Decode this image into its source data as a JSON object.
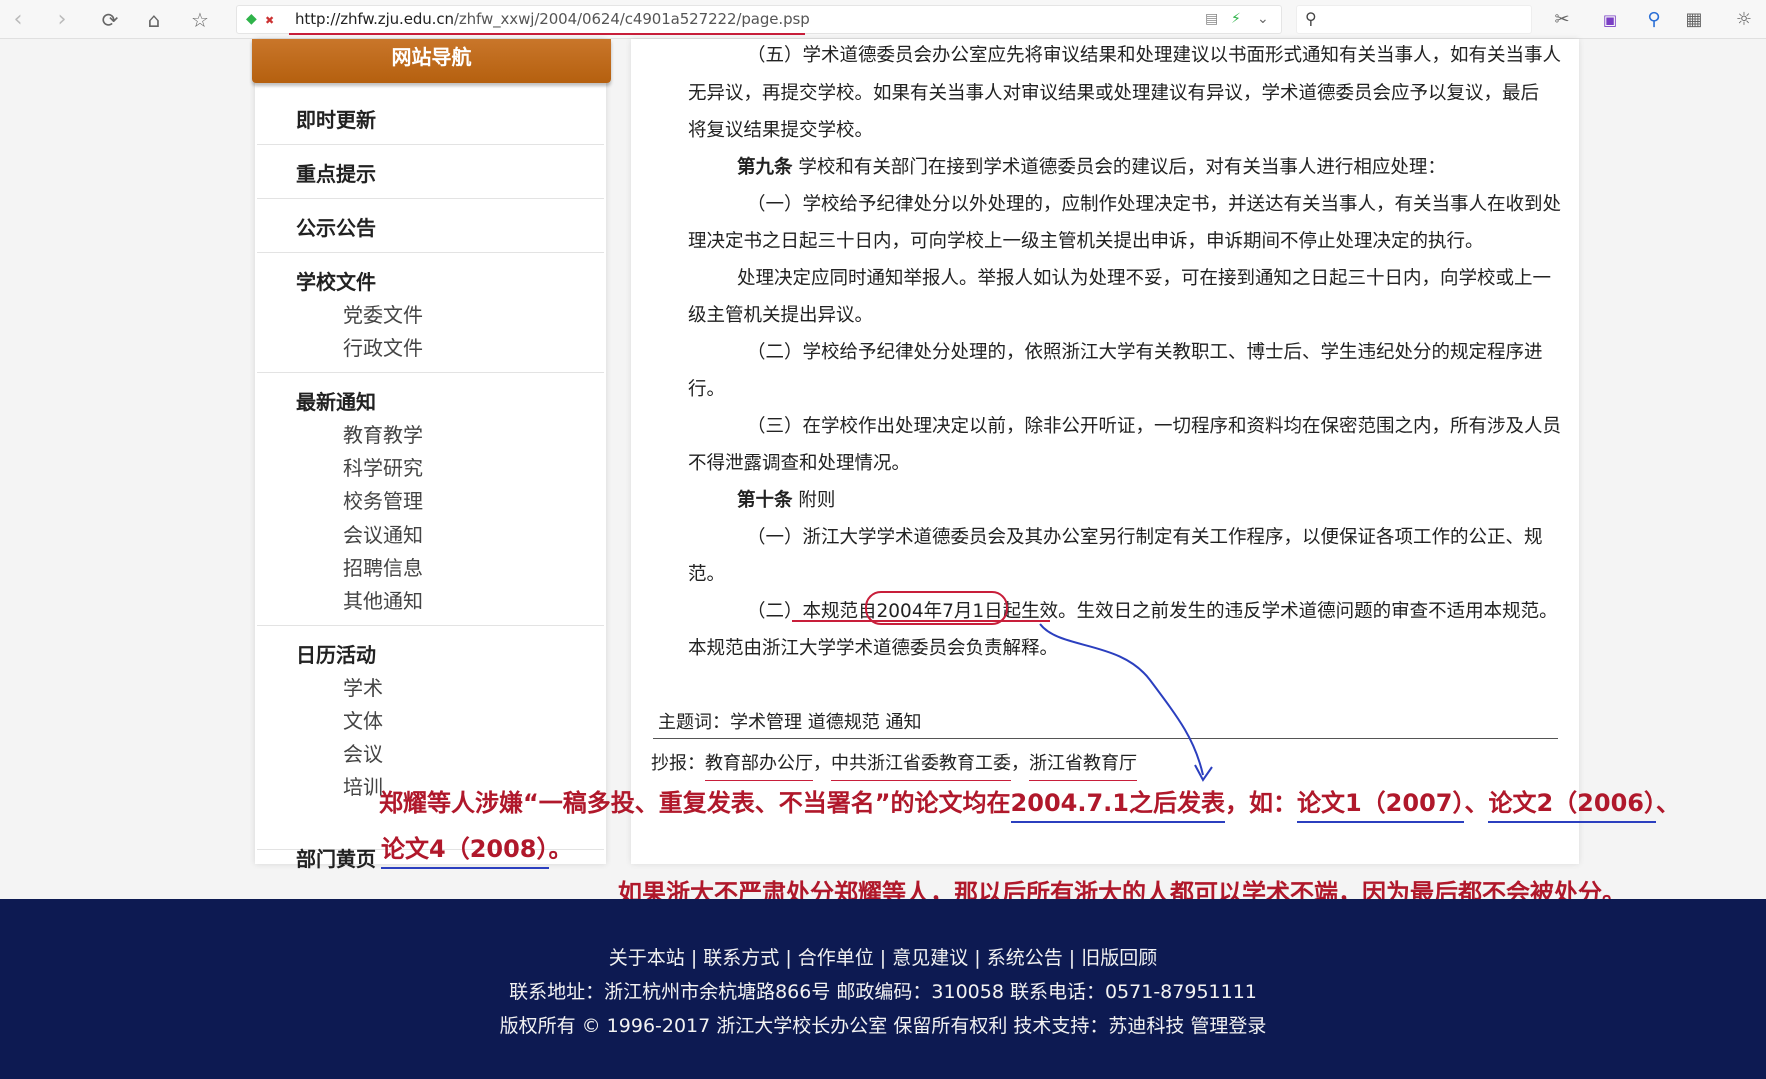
{
  "browser": {
    "url_host": "http://zhfw.zju.edu.cn",
    "url_path": "/zhfw_xxwj/2004/0624/c4901a527222/page.psp",
    "search_placeholder": "",
    "icons": [
      "back-icon",
      "forward-icon",
      "reload-icon",
      "home-icon",
      "star-icon",
      "shield-icon",
      "lightning-icon",
      "chevron-down-icon",
      "search-icon",
      "scissors-icon",
      "translate-icon",
      "zoom-icon",
      "grid-icon",
      "settings-icon"
    ]
  },
  "sidebar": {
    "title": "网站导航",
    "sections": [
      {
        "label": "即时更新",
        "items": []
      },
      {
        "label": "重点提示",
        "items": []
      },
      {
        "label": "公示公告",
        "items": []
      },
      {
        "label": "学校文件",
        "items": [
          "党委文件",
          "行政文件"
        ]
      },
      {
        "label": "最新通知",
        "items": [
          "教育教学",
          "科学研究",
          "校务管理",
          "会议通知",
          "招聘信息",
          "其他通知"
        ]
      },
      {
        "label": "日历活动",
        "items": [
          "学术",
          "文体",
          "会议",
          "培训"
        ]
      },
      {
        "label": "部门黄页",
        "items": []
      }
    ]
  },
  "article": {
    "p1_l1": "（五）学术道德委员会办公室应先将审议结果和处理建议以书面形式通知有关当事人，如有关当事人",
    "p1_l2": "无异议，再提交学校。如果有关当事人对审议结果或处理建议有异议，学术道德委员会应予以复议，最后",
    "p1_l3": "将复议结果提交学校。",
    "art9_title": "第九条",
    "art9_text": "学校和有关部门在接到学术道德委员会的建议后，对有关当事人进行相应处理：",
    "p2_l1": "（一）学校给予纪律处分以外处理的，应制作处理决定书，并送达有关当事人，有关当事人在收到处",
    "p2_l2": "理决定书之日起三十日内，可向学校上一级主管机关提出申诉，申诉期间不停止处理决定的执行。",
    "p3_l1": "处理决定应同时通知举报人。举报人如认为处理不妥，可在接到通知之日起三十日内，向学校或上一",
    "p3_l2": "级主管机关提出异议。",
    "p4_l1": "（二）学校给予纪律处分处理的，依照浙江大学有关教职工、博士后、学生违纪处分的规定程序进",
    "p4_l2": "行。",
    "p5_l1": "（三）在学校作出处理决定以前，除非公开听证，一切程序和资料均在保密范围之内，所有涉及人员",
    "p5_l2": "不得泄露调查和处理情况。",
    "art10_title": "第十条",
    "art10_text": "附则",
    "p6_l1": "（一）浙江大学学术道德委员会及其办公室另行制定有关工作程序，以便保证各项工作的公正、规",
    "p6_l2": "范。",
    "p7_prefix": "（二）本规范自",
    "p7_date": "2004年7月1日起",
    "p7_mid": "生效。",
    "p7_rest": "生效日之前发生的违反学术道德问题的审查不适用本规范。",
    "p7_l2": "本规范由浙江大学学术道德委员会负责解释。",
    "keywords_label": "主题词：学术管理  道德规范  通知",
    "copyto_label": "抄报：",
    "copyto_1": "教育部办公厅",
    "copyto_2": "中共浙江省委教育工委",
    "copyto_3": "浙江省教育厅",
    "sep": "，"
  },
  "annotation": {
    "line1_a": "郑耀等人涉嫌“一稿多投、重复发表、不当署名”的论文均在",
    "line1_date": "2004.7.1之后发表",
    "line1_b": "，如：",
    "paper1": "论文1（2007）",
    "dun": "、",
    "paper2": "论文2（2006）",
    "trail": "、",
    "paper4": "论文4（2008）",
    "end": "。",
    "line3": "如果浙大不严肃处分郑耀等人，那以后所有浙大的人都可以学术不端，因为最后都不会被处分。",
    "color": "#b0182b"
  },
  "footer": {
    "links": "关于本站 | 联系方式 | 合作单位 | 意见建议 | 系统公告 | 旧版回顾",
    "address": "联系地址：浙江杭州市余杭塘路866号 邮政编码：310058 联系电话：0571-87951111",
    "copyright": "版权所有 © 1996-2017 浙江大学校长办公室   保留所有权利   技术支持：苏迪科技   管理登录",
    "bg": "#0d1a52"
  }
}
